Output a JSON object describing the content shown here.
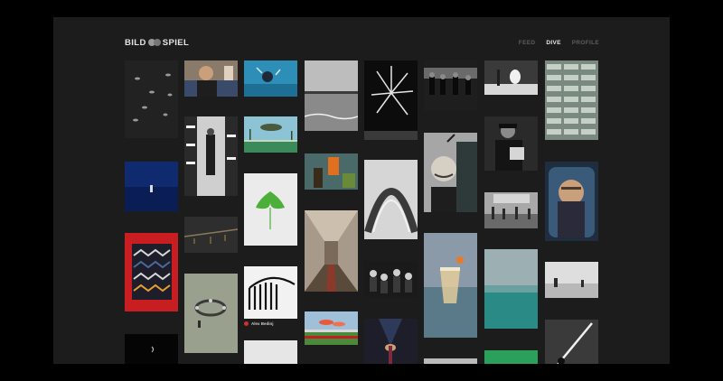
{
  "header": {
    "logo_left": "BILD",
    "logo_right": "SPIEL",
    "nav": [
      {
        "label": "FEED",
        "active": false
      },
      {
        "label": "DIVE",
        "active": true
      },
      {
        "label": "PROFILE",
        "active": false
      }
    ]
  },
  "gallery": {
    "caption_author": "Alex Bedinj"
  },
  "colors": {
    "background": "#000000",
    "panel": "#1c1c1c",
    "nav_active": "#e8e8e8",
    "nav_inactive": "#5c5c5c",
    "author_dot": "#d03030"
  }
}
